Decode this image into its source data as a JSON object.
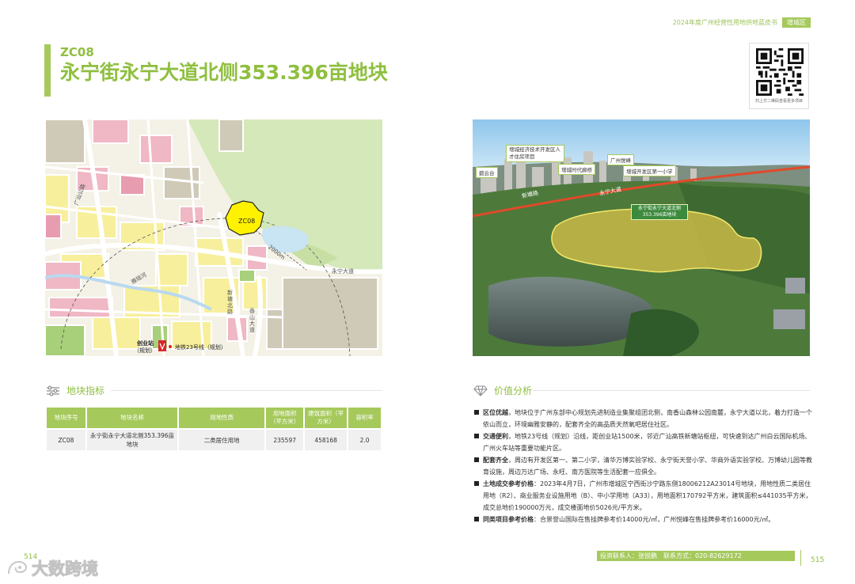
{
  "header": {
    "report_title": "2024年度广州经营性用地供地蓝皮书",
    "district_badge": "增城区"
  },
  "plot": {
    "code": "ZC08",
    "title": "永宁街永宁大道北侧353.396亩地块"
  },
  "qr": {
    "caption": "扫上方二维码查看更多项目"
  },
  "map": {
    "plot_label": "ZC08",
    "roads": {
      "xintang_north_road": "新塘北路",
      "yongning_road": "永宁大道",
      "xiangshan_road": "香山大道",
      "guangzhou_ring": "广汕公路",
      "chuangye_river": "雅瑶河"
    },
    "radius_label": "2000m",
    "station_name": "创业站",
    "station_note": "（规划）",
    "metro_label": "地铁23号线（规划）"
  },
  "photo": {
    "tags": {
      "a": "增城经济技术开发区人才住房项目",
      "b": "广州悦峰",
      "c": "增城时代廊桥",
      "d": "增城开发区第一小学",
      "e": "碧云台"
    },
    "roads": {
      "r1": "新塘路",
      "r2": "永宁大道"
    },
    "plot_label": "永宁街永宁大道北侧 353.396亩地块"
  },
  "indicators": {
    "heading": "地块指标",
    "columns": [
      "地块序号",
      "地块名称",
      "用地性质",
      "用地面积（平方米）",
      "建筑面积（平方米）",
      "容积率"
    ],
    "rows": [
      {
        "id": "ZC08",
        "name": "永宁街永宁大道北侧353.396亩地块",
        "use": "二类居住用地",
        "land_area": "235597",
        "floor_area": "458168",
        "far": "2.0"
      }
    ]
  },
  "analysis": {
    "heading": "价值分析",
    "items": [
      {
        "label": "区位优越",
        "text": "，地块位于广州东部中心规划先进制造业集聚组团北侧，南香山森林公园南麓，永宁大道以北，着力打造一个依山而立，环境幽雅安静的，配套齐全的高品质天然氧吧居住社区。"
      },
      {
        "label": "交通便利",
        "text": "，地铁23号线（规划）沿线，距创业站1500米，邻近广汕高铁新塘站枢纽，可快速到达广州白云国际机场、广州火车站等重要功能片区。"
      },
      {
        "label": "配套齐全",
        "text": "，周边有开发区第一、第二小学，清华万博实验学校、永宁街天誉小学、华商外语实验学校、万博幼儿园等教育设施，周边万达广场、永旺、南方医院等生活配套一应俱全。"
      },
      {
        "label": "土地成交参考价格",
        "text": "：2023年4月7日，广州市增城区宁西街沙宁路东侧18006212A23014号地块，用地性质二类居住用地（R2）、商业服务业设施用地（B）、中小学用地（A33），用地面积170792平方米，建筑面积≤441035平方米，成交总地价190000万元，成交楼面地价5026元/平方米。"
      },
      {
        "label": "同类项目参考价格",
        "text": "：合景誉山国际在售挂牌参考价14000元/㎡，广州悦峰在售挂牌参考价16000元/㎡。"
      }
    ]
  },
  "footer": {
    "contact": "投资联系人：张锐鹏　联系方式：020-82629172",
    "page_left": "514",
    "page_right": "515",
    "watermark": "大数跨境"
  }
}
